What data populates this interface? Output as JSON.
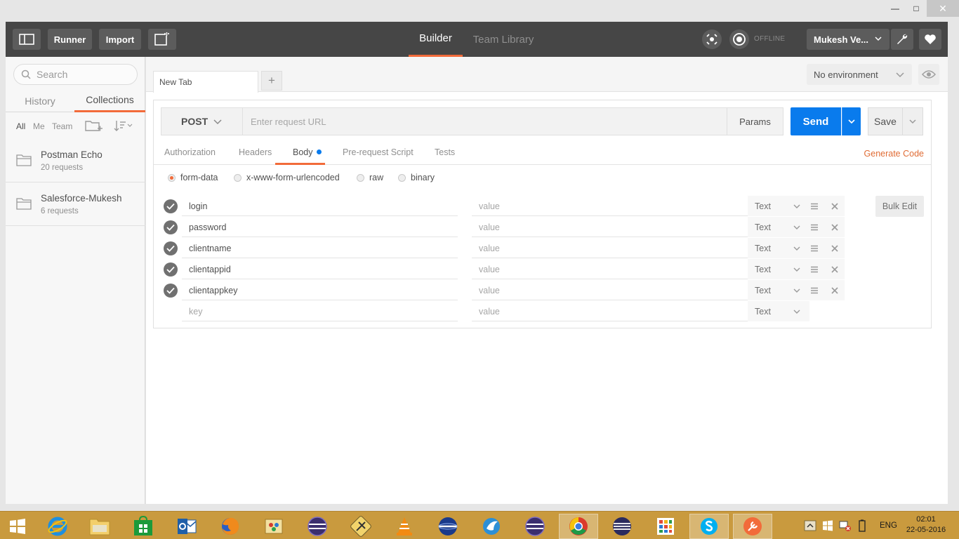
{
  "window": {
    "minimize": "—",
    "maximize": "□",
    "close": "✕"
  },
  "header": {
    "runner": "Runner",
    "import": "Import",
    "tabs": [
      {
        "label": "Builder",
        "active": true
      },
      {
        "label": "Team Library",
        "active": false
      }
    ],
    "status": "OFFLINE",
    "user": "Mukesh Ve...",
    "accent": "#f26b3a"
  },
  "sidebar": {
    "search_placeholder": "Search",
    "tabs": {
      "history": "History",
      "collections": "Collections"
    },
    "filters": {
      "all": "All",
      "me": "Me",
      "team": "Team"
    },
    "collections": [
      {
        "name": "Postman Echo",
        "count": "20 requests"
      },
      {
        "name": "Salesforce-Mukesh",
        "count": "6 requests"
      }
    ]
  },
  "main": {
    "tab_label": "New Tab",
    "add_tab": "+",
    "environment": "No environment",
    "request": {
      "method": "POST",
      "url_placeholder": "Enter request URL",
      "url_value": "",
      "params": "Params",
      "send": "Send",
      "save": "Save",
      "send_color": "#097bed"
    },
    "subtabs": [
      "Authorization",
      "Headers",
      "Body",
      "Pre-request Script",
      "Tests"
    ],
    "active_subtab": "Body",
    "generate_code": "Generate Code",
    "body_modes": [
      "form-data",
      "x-www-form-urlencoded",
      "raw",
      "binary"
    ],
    "selected_body_mode": "form-data",
    "bulk_edit": "Bulk Edit",
    "rows": [
      {
        "key": "login",
        "value_placeholder": "value",
        "type": "Text"
      },
      {
        "key": "password",
        "value_placeholder": "value",
        "type": "Text"
      },
      {
        "key": "clientname",
        "value_placeholder": "value",
        "type": "Text"
      },
      {
        "key": "clientappid",
        "value_placeholder": "value",
        "type": "Text"
      },
      {
        "key": "clientappkey",
        "value_placeholder": "value",
        "type": "Text"
      }
    ],
    "new_row": {
      "key_placeholder": "key",
      "value_placeholder": "value",
      "type": "Text"
    }
  },
  "taskbar": {
    "language": "ENG",
    "time": "02:01",
    "date": "22-05-2016",
    "color": "#c99a3e"
  }
}
